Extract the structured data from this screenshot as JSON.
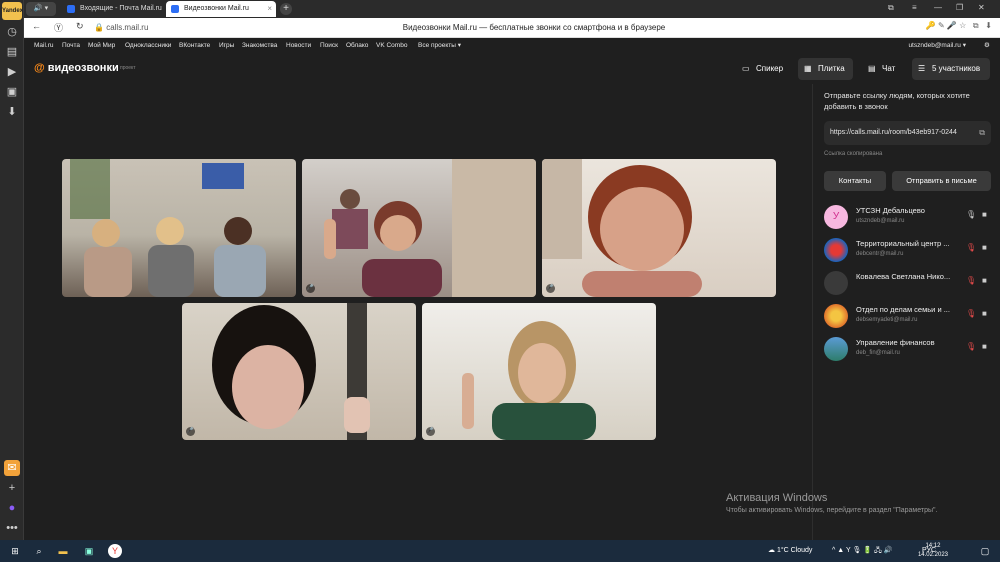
{
  "browser": {
    "logo": "Yandex",
    "tabs": [
      {
        "label": "Входящие - Почта Mail.ru",
        "active": false
      },
      {
        "label": "Видеозвонки Mail.ru",
        "active": true
      }
    ],
    "url": "calls.mail.ru",
    "page_title": "Видеозвонки Mail.ru — бесплатные звонки со смартфона и в браузере"
  },
  "portal": {
    "links": [
      "Mail.ru",
      "Почта",
      "Мой Мир",
      "Одноклассники",
      "ВКонтакте",
      "Игры",
      "Знакомства",
      "Новости",
      "Поиск",
      "Облако",
      "VK Combo",
      "Все проекты ▾"
    ],
    "user": "utszndeb@mail.ru ▾"
  },
  "app": {
    "logo_text": "видеозвонки",
    "logo_sub": "проект",
    "views": [
      {
        "label": "Спикер",
        "icon": "speaker-view-icon"
      },
      {
        "label": "Плитка",
        "icon": "grid-view-icon"
      },
      {
        "label": "Чат",
        "icon": "chat-icon"
      },
      {
        "label": "5 участников",
        "icon": "participants-icon"
      }
    ]
  },
  "panel": {
    "intro": "Отправьте ссылку людям, которых хотите добавить в звонок",
    "link": "https://calls.mail.ru/room/b43eb917-0244",
    "copied": "Ссылка скопирована",
    "contacts_btn": "Контакты",
    "send_mail_btn": "Отправить в письме",
    "participants": [
      {
        "name": "УТСЗН Дебальцево",
        "email": "utszndeb@mail.ru",
        "avatar_letter": "У"
      },
      {
        "name": "Территориальный центр ...",
        "email": "debcentr@mail.ru",
        "avatar_letter": ""
      },
      {
        "name": "Ковалева Светлана Нико...",
        "email": "",
        "avatar_letter": ""
      },
      {
        "name": "Отдел по делам семьи и ...",
        "email": "debsemyadeti@mail.ru",
        "avatar_letter": ""
      },
      {
        "name": "Управление финансов",
        "email": "deb_fin@mail.ru",
        "avatar_letter": ""
      }
    ]
  },
  "activation": {
    "title": "Активация Windows",
    "sub": "Чтобы активировать Windows, перейдите в раздел \"Параметры\"."
  },
  "taskbar": {
    "weather": "1°C  Cloudy",
    "lang": "РУС",
    "time": "14:12",
    "date": "14.02.2023"
  }
}
